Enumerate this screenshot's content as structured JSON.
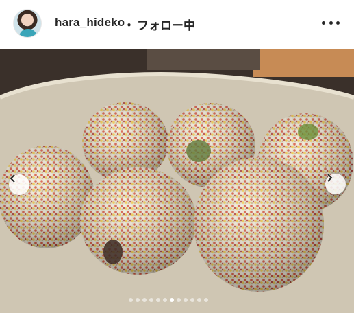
{
  "post": {
    "username": "hara_hideko",
    "separator": "・",
    "follow_status": "フォロー中",
    "more_icon": "more-horizontal-icon",
    "avatar": "profile-avatar"
  },
  "media": {
    "subject": "food-photo",
    "prev_icon": "chevron-left-icon",
    "next_icon": "chevron-right-icon",
    "carousel": {
      "count": 12,
      "active_index": 6
    }
  }
}
